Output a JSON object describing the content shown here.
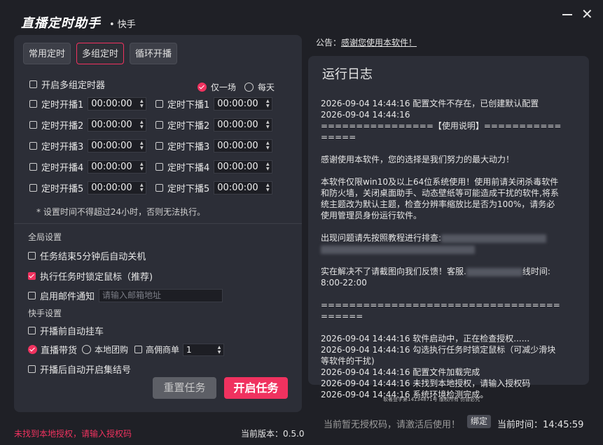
{
  "app": {
    "title": "直播定时助手",
    "subtitle": "• 快手",
    "minimize_label": "",
    "close_label": "✕"
  },
  "tabs": [
    {
      "label": "常用定时",
      "active": false
    },
    {
      "label": "多组定时",
      "active": true
    },
    {
      "label": "循环开播",
      "active": false
    }
  ],
  "multi": {
    "enable_label": "开启多组定时器",
    "once_label": "仅一场",
    "daily_label": "每天",
    "start_rows": [
      {
        "label": "定时开播1",
        "value": "00:00:00"
      },
      {
        "label": "定时开播2",
        "value": "00:00:00"
      },
      {
        "label": "定时开播3",
        "value": "00:00:00"
      },
      {
        "label": "定时开播4",
        "value": "00:00:00"
      },
      {
        "label": "定时开播5",
        "value": "00:00:00"
      }
    ],
    "stop_rows": [
      {
        "label": "定时下播1",
        "value": "00:00:00"
      },
      {
        "label": "定时下播2",
        "value": "00:00:00"
      },
      {
        "label": "定时下播3",
        "value": "00:00:00"
      },
      {
        "label": "定时下播4",
        "value": "00:00:00"
      },
      {
        "label": "定时下播5",
        "value": "00:00:00"
      }
    ],
    "note": "* 设置时间不得超过24小时，否则无法执行。"
  },
  "global": {
    "section_label": "全局设置",
    "shutdown_label": "任务结束5分钟后自动关机",
    "lock_mouse_label": "执行任务时锁定鼠标（推荐)",
    "email_label": "启用邮件通知",
    "email_placeholder": "请输入邮箱地址"
  },
  "kuaishou": {
    "section_label": "快手设置",
    "auto_car_label": "开播前自动挂车",
    "live_goods_label": "直播带货",
    "local_group_label": "本地团购",
    "high_comm_label": "高佣商单",
    "high_comm_value": "1",
    "auto_collect_label": "开播后自动开启集结号"
  },
  "buttons": {
    "reset_label": "重置任务",
    "start_label": "开启任务"
  },
  "footer": {
    "license_warning": "未找到本地授权，请输入授权码",
    "version": "当前版本：0.5.0",
    "copyright": "软著登字第14134871号 版权所有 仿冒必究",
    "status_text": "当前暂无授权码，请激活后使用！",
    "bind_label": "绑定",
    "time_label": "当前时间：14:45:59"
  },
  "notice": {
    "prefix": "公告：",
    "link": "感谢您使用本软件！"
  },
  "log": {
    "title": "运行日志",
    "lines": [
      "2026-09-04 14:44:16 配置文件不存在，已创建默认配置",
      "2026-09-04 14:44:16",
      "================【使用说明】================",
      "",
      "感谢使用本软件，您的选择是我们努力的最大动力！",
      "",
      "本软件仅限win10及以上64位系统使用！使用前请关闭杀毒软件和防火墙，关闭桌面助手、动态壁纸等可能造成干扰的软件,将系统主题改为默认主题，检查分辨率缩放比是否为100%，请务必使用管理员身份运行软件。",
      "",
      "出现问题请先按照教程进行排查:",
      "",
      "",
      "实在解决不了请截图向我们反馈！客服.",
      "8:00-22:00",
      "",
      "========================================",
      "",
      "2026-09-04 14:44:16 软件启动中，正在检查授权......",
      "2026-09-04 14:44:16 勾选执行任务时锁定鼠标（可减少滑块等软件的干扰)",
      "2026-09-04 14:44:16 配置文件加载完成",
      "2026-09-04 14:44:16 未找到本地授权，请输入授权码",
      "2026-09-04 14:44:16 系统环境检测完成。"
    ],
    "hotline_suffix": "线时间:"
  },
  "colors": {
    "accent": "#f0325f",
    "bg": "#1f2026",
    "panel": "#2c2e37"
  }
}
